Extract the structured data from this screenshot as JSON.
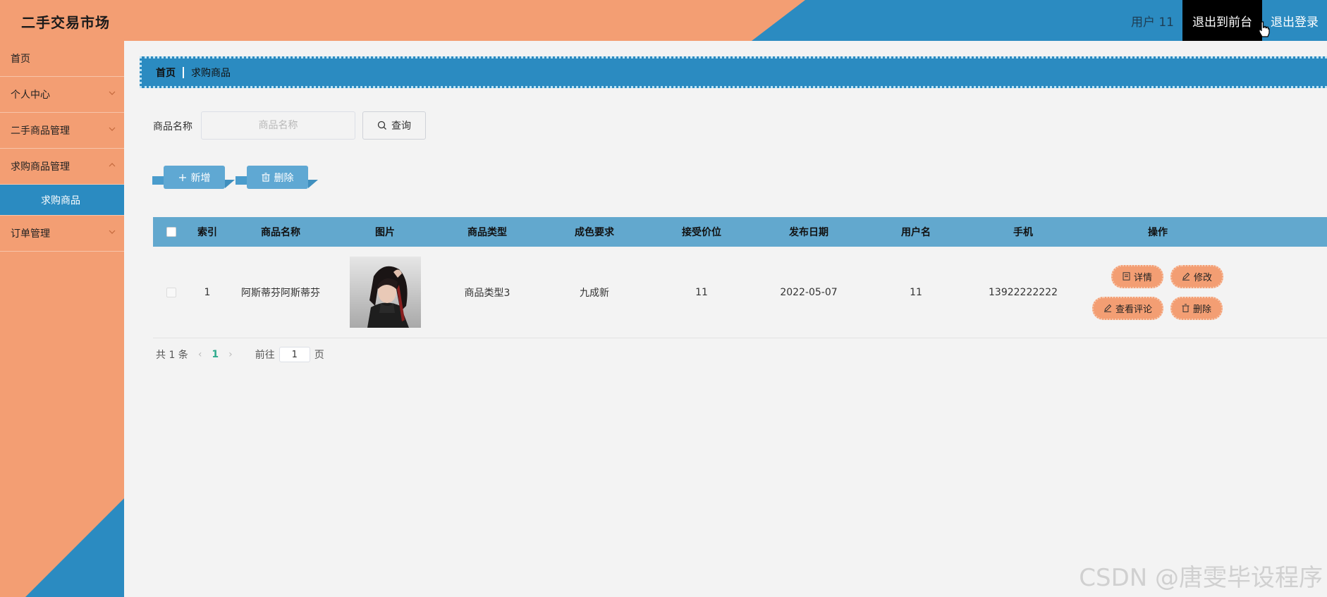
{
  "header": {
    "app_title": "二手交易市场",
    "user_label": "用户 11",
    "back_to_front": "退出到前台",
    "logout": "退出登录",
    "colors": {
      "orange": "#f39e73",
      "blue": "#2b8bc1"
    }
  },
  "sidebar": {
    "items": [
      {
        "label": "首页"
      },
      {
        "label": "个人中心"
      },
      {
        "label": "二手商品管理"
      },
      {
        "label": "求购商品管理"
      },
      {
        "label": "订单管理"
      }
    ],
    "active_sub": "求购商品"
  },
  "breadcrumb": {
    "home": "首页",
    "current": "求购商品"
  },
  "search": {
    "label": "商品名称",
    "placeholder": "商品名称",
    "button": "查询"
  },
  "actions": {
    "add": "新增",
    "delete": "删除"
  },
  "table": {
    "columns": [
      "索引",
      "商品名称",
      "图片",
      "商品类型",
      "成色要求",
      "接受价位",
      "发布日期",
      "用户名",
      "手机",
      "操作"
    ],
    "rows": [
      {
        "index": "1",
        "name": "阿斯蒂芬阿斯蒂芬",
        "type": "商品类型3",
        "condition": "九成新",
        "price": "11",
        "date": "2022-05-07",
        "username": "11",
        "phone": "13922222222",
        "ops": {
          "detail": "详情",
          "edit": "修改",
          "comments": "查看评论",
          "delete": "删除"
        }
      }
    ]
  },
  "pagination": {
    "total": "共 1 条",
    "current_page": "1",
    "goto": "前往",
    "page_value": "1",
    "page_suffix": "页"
  },
  "watermark": "CSDN @唐雯毕设程序"
}
